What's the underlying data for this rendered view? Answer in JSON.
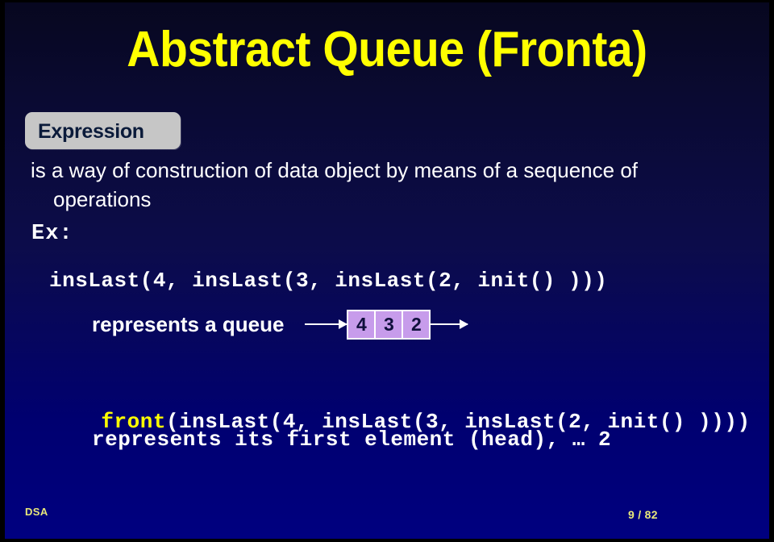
{
  "slide": {
    "title": "Abstract Queue (Fronta)",
    "background_top_color": "#07071f",
    "background_bottom_color": "#000080",
    "title_color": "#ffff00"
  },
  "definition": {
    "term_label": "Expression",
    "term_box_color": "#c6c6c6",
    "term_text_color": "#0b1b3a",
    "line_1": "is a way of construction of data object by means of a sequence of",
    "line_2": "operations"
  },
  "example": {
    "label": "Ex:",
    "expression_code": "insLast(4, insLast(3, insLast(2, init() )))",
    "queue": {
      "caption": "represents a queue",
      "in_arrow": "arrow-right",
      "cells": [
        "4",
        "3",
        "2"
      ],
      "out_arrow": "arrow-right",
      "cell_color": "#c79ceb",
      "cell_text_color": "#10103c"
    }
  },
  "front_example": {
    "keyword": "front",
    "keyword_color": "#ffff00",
    "expression_code": "(insLast(4, insLast(3, insLast(2, init() ))))",
    "result_text": "represents its first element (head), … 2"
  },
  "footer": {
    "course": "DSA",
    "page": "9 / 82",
    "color": "#e8e87a"
  }
}
